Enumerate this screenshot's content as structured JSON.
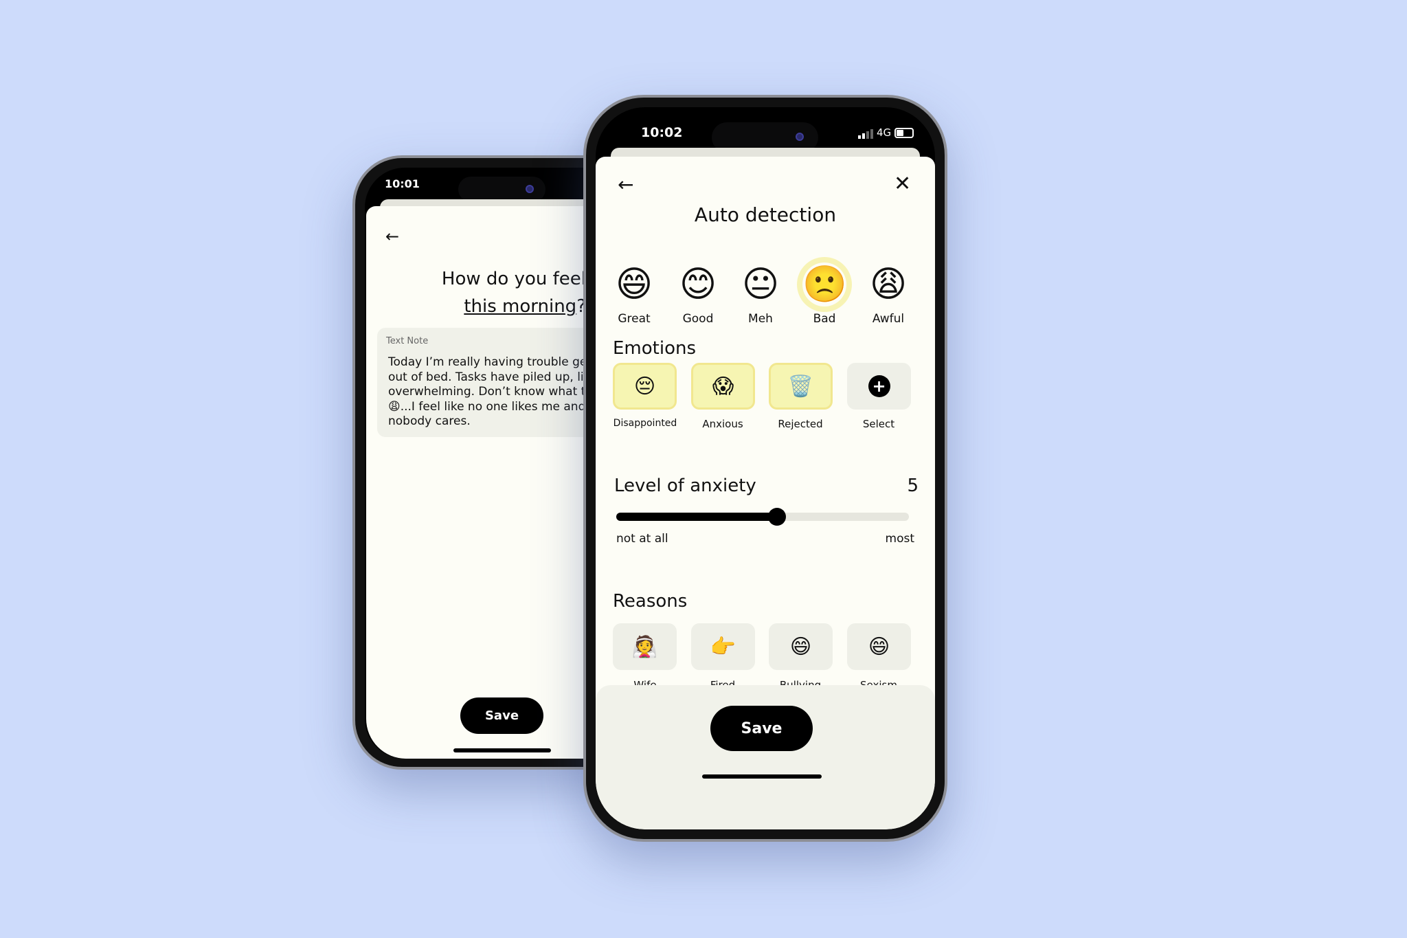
{
  "back_phone": {
    "status_time": "10:01",
    "title_line1": "How do you feel",
    "title_highlight": "this morning",
    "title_suffix": "?",
    "note_label": "Text Note",
    "note_lines": [
      "Today I’m really having trouble gett",
      "out of bed. Tasks have piled up, life",
      "overwhelming. Don’t know what to",
      "😩...I feel like no one likes me and",
      "nobody cares."
    ],
    "save_label": "Save"
  },
  "front_phone": {
    "status_time": "10:02",
    "network": "4G",
    "battery_percent": 45,
    "title": "Auto detection",
    "moods": [
      {
        "emoji": "😄",
        "label": "Great"
      },
      {
        "emoji": "😊",
        "label": "Good"
      },
      {
        "emoji": "😐",
        "label": "Meh"
      },
      {
        "emoji": "🙁",
        "label": "Bad"
      },
      {
        "emoji": "😩",
        "label": "Awful"
      }
    ],
    "selected_mood": "Bad",
    "emotions_title": "Emotions",
    "emotions": [
      {
        "emoji": "😔",
        "label": "Disappointed",
        "selected": true
      },
      {
        "emoji": "😱",
        "label": "Anxious",
        "selected": true
      },
      {
        "emoji": "🗑️",
        "label": "Rejected",
        "selected": true
      },
      {
        "emoji": "+",
        "label": "Select",
        "selected": false
      }
    ],
    "anxiety": {
      "title": "Level of anxiety",
      "value": "5",
      "fill_fraction": 0.55,
      "min_label": "not at all",
      "max_label": "most"
    },
    "reasons_title": "Reasons",
    "reasons": [
      {
        "emoji": "👰",
        "label": "Wife"
      },
      {
        "emoji": "👉",
        "label": "Fired"
      },
      {
        "emoji": "😄",
        "label": "Bullying"
      },
      {
        "emoji": "😄",
        "label": "Sexism"
      }
    ],
    "save_label": "Save"
  },
  "colors": {
    "background": "#cddbfb",
    "card": "#fdfdf6",
    "selected_tile": "#f6f5b2",
    "accent": "#000000"
  }
}
